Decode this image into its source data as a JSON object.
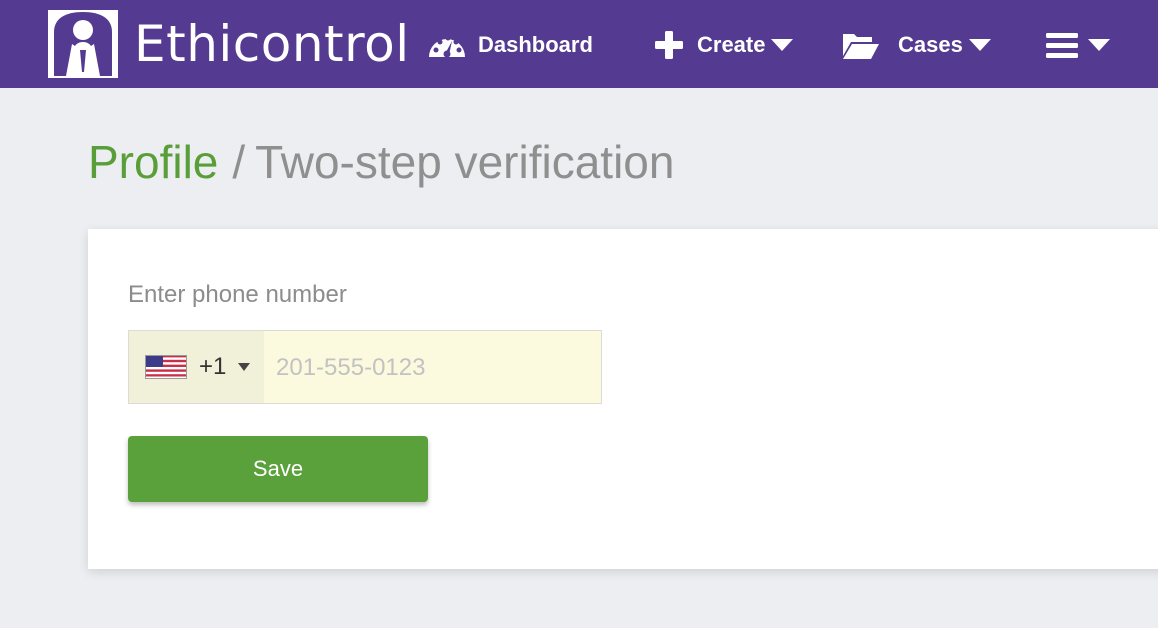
{
  "header": {
    "brand": "Ethicontrol",
    "nav": {
      "dashboard": "Dashboard",
      "create": "Create",
      "cases": "Cases"
    },
    "icons": [
      "logo-person-icon",
      "dashboard-gauge-icon",
      "plus-icon",
      "folder-open-icon",
      "hamburger-menu-icon",
      "caret-down-icon"
    ]
  },
  "breadcrumb": {
    "parent": "Profile",
    "separator": "/",
    "current": "Two-step verification"
  },
  "form": {
    "label": "Enter phone number",
    "country_code": "+1",
    "phone_value": "",
    "phone_placeholder": "201-555-0123",
    "save_label": "Save"
  },
  "colors": {
    "header_bg": "#543a90",
    "accent_green": "#5aa03b",
    "page_bg": "#eceef2",
    "input_bg": "#fbfadf"
  }
}
